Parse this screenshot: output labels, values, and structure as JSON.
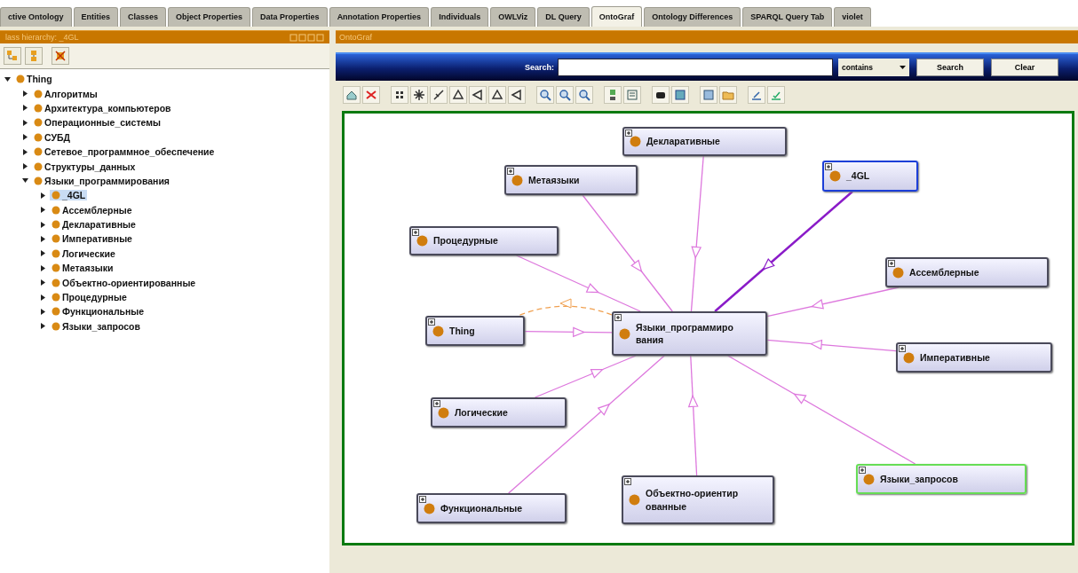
{
  "tabs": [
    {
      "label": "ctive Ontology",
      "selected": false
    },
    {
      "label": "Entities",
      "selected": false
    },
    {
      "label": "Classes",
      "selected": false
    },
    {
      "label": "Object Properties",
      "selected": false
    },
    {
      "label": "Data Properties",
      "selected": false
    },
    {
      "label": "Annotation Properties",
      "selected": false
    },
    {
      "label": "Individuals",
      "selected": false
    },
    {
      "label": "OWLViz",
      "selected": false
    },
    {
      "label": "DL Query",
      "selected": false
    },
    {
      "label": "OntoGraf",
      "selected": true
    },
    {
      "label": "Ontology Differences",
      "selected": false
    },
    {
      "label": "SPARQL Query Tab",
      "selected": false
    },
    {
      "label": "violet",
      "selected": false
    }
  ],
  "class_panel": {
    "title": "lass hierarchy: _4GL"
  },
  "tree": {
    "items": [
      {
        "label": "Thing",
        "expanded": true,
        "selected": false,
        "children": [
          {
            "label": "Алгоритмы",
            "expanded": false,
            "selected": false
          },
          {
            "label": "Архитектура_компьютеров",
            "expanded": false,
            "selected": false
          },
          {
            "label": "Операционные_системы",
            "expanded": false,
            "selected": false
          },
          {
            "label": "СУБД",
            "expanded": false,
            "selected": false
          },
          {
            "label": "Сетевое_программное_обеспечение",
            "expanded": false,
            "selected": false
          },
          {
            "label": "Структуры_данных",
            "expanded": false,
            "selected": false
          },
          {
            "label": "Языки_программирования",
            "expanded": true,
            "selected": false,
            "children": [
              {
                "label": "_4GL",
                "expanded": false,
                "selected": true
              },
              {
                "label": "Ассемблерные",
                "expanded": false,
                "selected": false
              },
              {
                "label": "Декларативные",
                "expanded": false,
                "selected": false
              },
              {
                "label": "Императивные",
                "expanded": false,
                "selected": false
              },
              {
                "label": "Логические",
                "expanded": false,
                "selected": false
              },
              {
                "label": "Метаязыки",
                "expanded": false,
                "selected": false
              },
              {
                "label": "Объектно-ориентированные",
                "expanded": false,
                "selected": false
              },
              {
                "label": "Процедурные",
                "expanded": false,
                "selected": false
              },
              {
                "label": "Функциональные",
                "expanded": false,
                "selected": false
              },
              {
                "label": "Языки_запросов",
                "expanded": false,
                "selected": false
              }
            ]
          }
        ]
      }
    ]
  },
  "graf_panel": {
    "title": "OntoGraf"
  },
  "search": {
    "label": "Search:",
    "mode": "contains",
    "buttons": [
      "Search",
      "Clear"
    ]
  },
  "graph": {
    "nodes": [
      {
        "label": "Декларативные",
        "kind": "sub",
        "selected": false,
        "highlighted": false
      },
      {
        "label": "Метаязыки",
        "kind": "sub",
        "selected": false,
        "highlighted": false
      },
      {
        "label": "_4GL",
        "kind": "sub",
        "selected": true,
        "highlighted": false
      },
      {
        "label": "Процедурные",
        "kind": "sub",
        "selected": false,
        "highlighted": false
      },
      {
        "label": "Ассемблерные",
        "kind": "sub",
        "selected": false,
        "highlighted": false
      },
      {
        "label": "Thing",
        "kind": "super",
        "selected": false,
        "highlighted": false
      },
      {
        "label": "Языки_программирования",
        "kind": "center",
        "selected": false,
        "highlighted": false
      },
      {
        "label": "Императивные",
        "kind": "sub",
        "selected": false,
        "highlighted": false
      },
      {
        "label": "Логические",
        "kind": "sub",
        "selected": false,
        "highlighted": false
      },
      {
        "label": "Языки_запросов",
        "kind": "sub",
        "selected": false,
        "highlighted": true
      },
      {
        "label": "Функциональные",
        "kind": "sub",
        "selected": false,
        "highlighted": false
      },
      {
        "label": "Объектно-ориентированные",
        "kind": "sub",
        "selected": false,
        "highlighted": false
      }
    ]
  }
}
